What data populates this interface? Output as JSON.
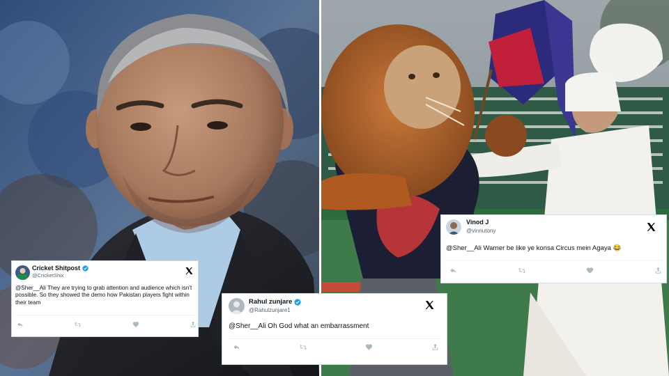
{
  "tweets": {
    "cricket_shitpost": {
      "name": "Cricket Shitpost",
      "handle": "@CricketShix",
      "text": "@Sher__Ali They are trying to grab attention and audience which isn't possible. So they showed the demo how Pakistan players fight within their team",
      "verified": true
    },
    "rahul": {
      "name": "Rahul zunjare",
      "handle": "@Rahulzunjare1",
      "text": "@Sher__Ali Oh God what an embarrassment",
      "verified": true
    },
    "vinod": {
      "name": "Vinod J",
      "handle": "@vinnutony",
      "text": "@Sher__Ali Warner be like ye konsa Circus mein Agaya 😂",
      "verified": false
    }
  },
  "colors": {
    "verified_badge": "#1d9bf0",
    "action_icon": "#aab8c2",
    "card_border": "#cfd9de"
  },
  "icons": [
    "reply-icon",
    "retweet-icon",
    "like-icon",
    "share-icon",
    "x-logo-icon",
    "verified-badge-icon"
  ]
}
